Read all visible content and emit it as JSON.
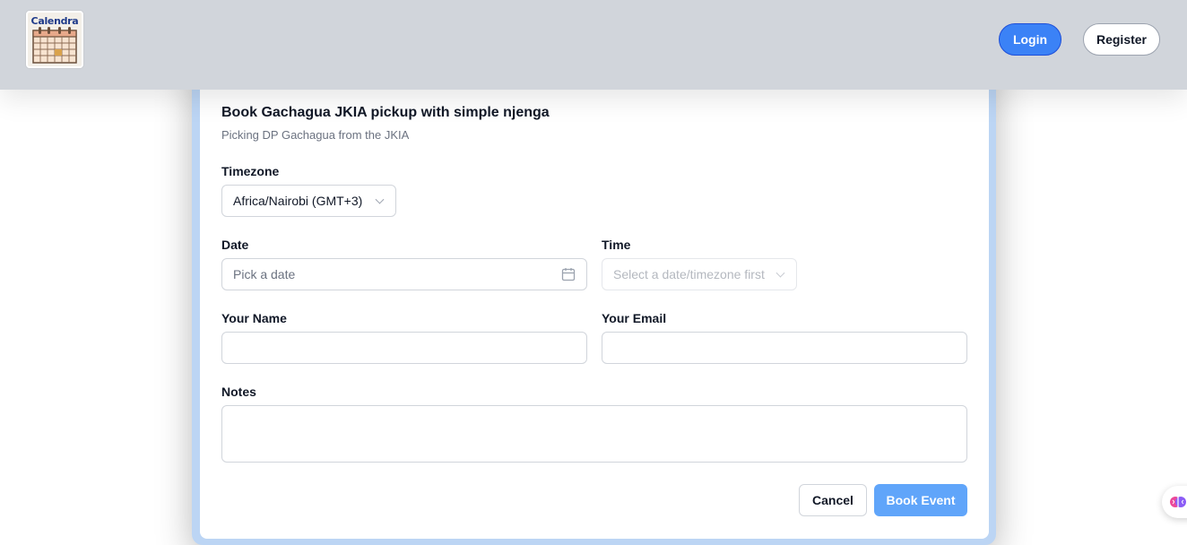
{
  "header": {
    "logo_text": "Calendra",
    "login_label": "Login",
    "register_label": "Register"
  },
  "event": {
    "title": "Book Gachagua JKIA pickup with simple njenga",
    "description": "Picking DP Gachagua from the JKIA"
  },
  "form": {
    "timezone_label": "Timezone",
    "timezone_value": "Africa/Nairobi (GMT+3)",
    "date_label": "Date",
    "date_placeholder": "Pick a date",
    "time_label": "Time",
    "time_placeholder": "Select a date/timezone first",
    "name_label": "Your Name",
    "name_value": "",
    "email_label": "Your Email",
    "email_value": "",
    "notes_label": "Notes",
    "notes_value": ""
  },
  "actions": {
    "cancel_label": "Cancel",
    "book_label": "Book Event"
  },
  "icons": {
    "logo": "calendar-logo-icon",
    "date_picker": "calendar-icon",
    "timezone_dropdown": "chevron-down-icon",
    "time_dropdown": "chevron-down-icon",
    "floating": "brain-icon"
  },
  "colors": {
    "header_bg": "#d1d5db",
    "primary": "#3b82f6",
    "book_button": "#60a5fa",
    "modal_border": "#bcd5f4"
  }
}
